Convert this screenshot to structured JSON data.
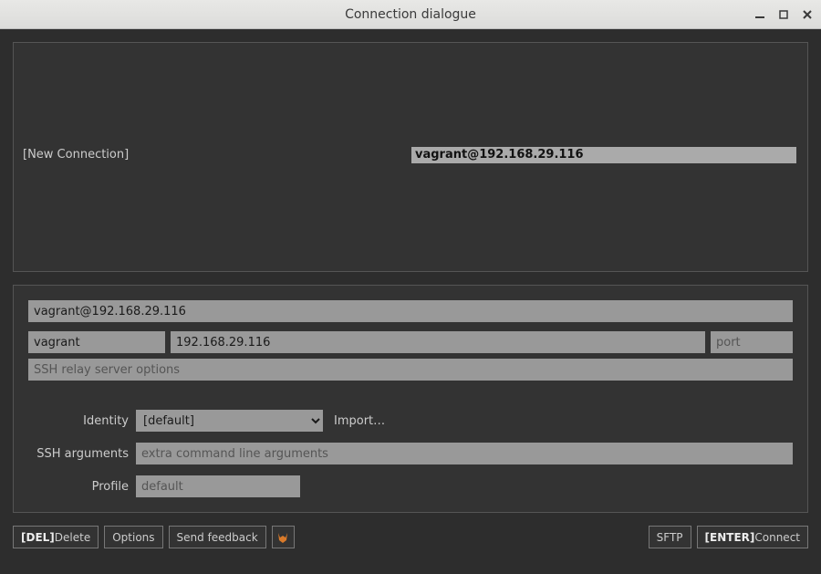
{
  "window": {
    "title": "Connection dialogue"
  },
  "list": {
    "new_connection_label": "[New Connection]",
    "selected_label": "vagrant@192.168.29.116"
  },
  "form": {
    "description_value": "vagrant@192.168.29.116",
    "user_value": "vagrant",
    "host_value": "192.168.29.116",
    "port_placeholder": "port",
    "relay_placeholder": "SSH relay server options",
    "identity_label": "Identity",
    "identity_selected": "[default]",
    "import_label": "Import…",
    "ssh_args_label": "SSH arguments",
    "ssh_args_placeholder": "extra command line arguments",
    "profile_label": "Profile",
    "profile_placeholder": "default"
  },
  "buttons": {
    "delete_key": "[DEL]",
    "delete_label": " Delete",
    "options_label": "Options",
    "feedback_label": "Send feedback",
    "sftp_label": "SFTP",
    "connect_key": "[ENTER]",
    "connect_label": " Connect"
  }
}
